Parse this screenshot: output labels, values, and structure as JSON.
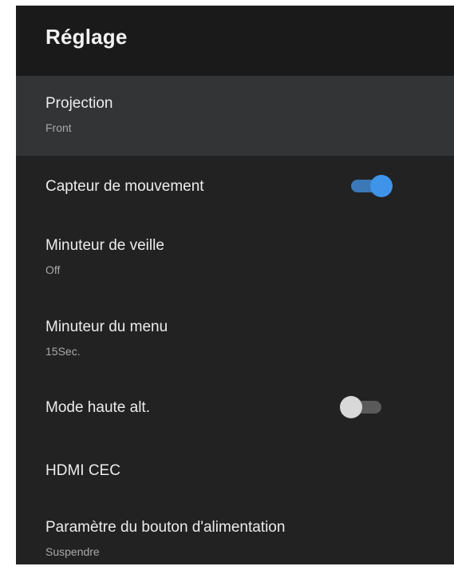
{
  "header": {
    "title": "Réglage"
  },
  "colors": {
    "accent": "#3f94ea",
    "background": "#222222",
    "header_background": "#1a1a1a",
    "selected_row": "#333436"
  },
  "settings": [
    {
      "label": "Projection",
      "value": "Front",
      "selected": true
    },
    {
      "label": "Capteur de mouvement",
      "toggle": "on"
    },
    {
      "label": "Minuteur de veille",
      "value": "Off"
    },
    {
      "label": "Minuteur du menu",
      "value": "15Sec."
    },
    {
      "label": "Mode haute alt.",
      "toggle": "off"
    },
    {
      "label": "HDMI CEC"
    },
    {
      "label": "Paramètre du bouton d'alimentation",
      "value": "Suspendre"
    }
  ]
}
